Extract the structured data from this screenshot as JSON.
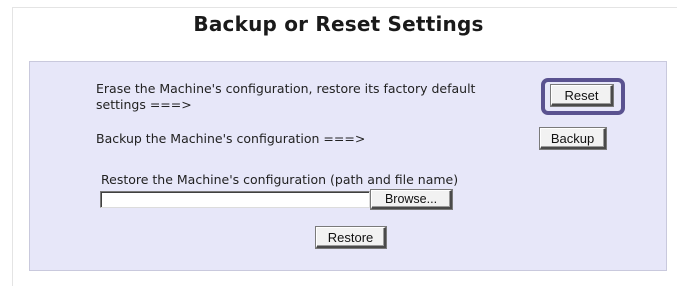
{
  "page": {
    "title": "Backup or Reset Settings"
  },
  "reset": {
    "description_line1": "Erase the Machine's configuration, restore its factory default",
    "description_line2": "settings ===>",
    "button_label": "Reset"
  },
  "backup": {
    "description": "Backup the Machine's configuration ===>",
    "button_label": "Backup"
  },
  "restore": {
    "description": "Restore the Machine's configuration (path and file name)",
    "file_value": "",
    "browse_label": "Browse...",
    "button_label": "Restore"
  },
  "colors": {
    "panel_background": "#e7e7f9",
    "highlight_border": "#5a5290"
  }
}
